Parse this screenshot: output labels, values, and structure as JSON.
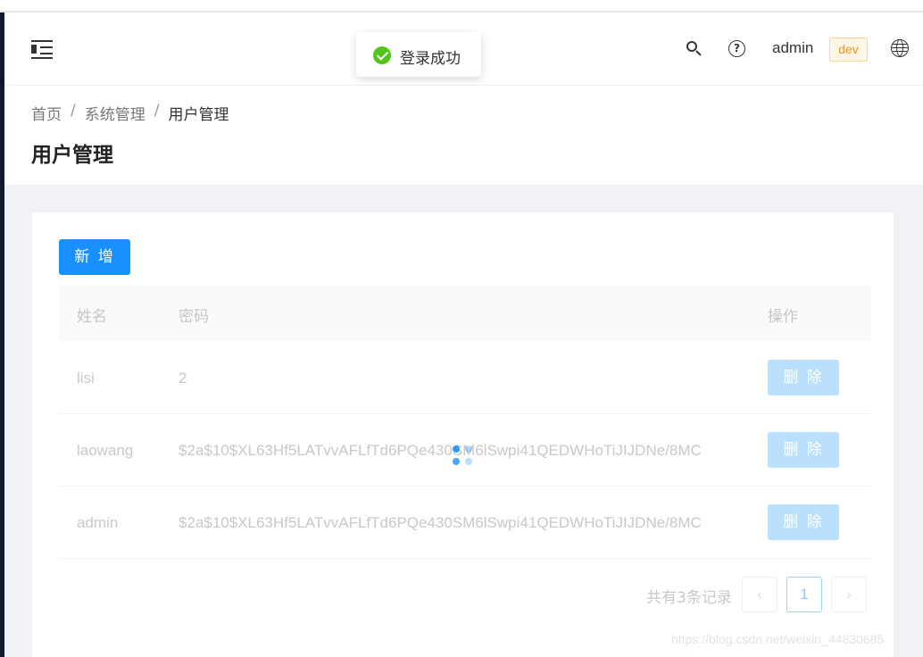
{
  "header": {
    "user_name": "admin",
    "env_badge": "dev",
    "colors": {
      "accent": "#1890ff",
      "badge_text": "#fa8c16",
      "success": "#52c41a"
    }
  },
  "toast": {
    "message": "登录成功",
    "icon": "check-circle-icon"
  },
  "breadcrumb": {
    "items": [
      "首页",
      "系统管理",
      "用户管理"
    ],
    "separator": "/"
  },
  "page": {
    "title": "用户管理"
  },
  "toolbar": {
    "add_label": "新 增"
  },
  "table": {
    "columns": [
      "姓名",
      "密码",
      "操作"
    ],
    "rows": [
      {
        "name": "lisi",
        "password": "2",
        "action": "删 除"
      },
      {
        "name": "laowang",
        "password": "$2a$10$XL63Hf5LATvvAFLfTd6PQe430SM6lSwpi41QEDWHoTiJIJDNe/8MC",
        "action": "删 除"
      },
      {
        "name": "admin",
        "password": "$2a$10$XL63Hf5LATvvAFLfTd6PQe430SM6lSwpi41QEDWHoTiJIJDNe/8MC",
        "action": "删 除"
      }
    ]
  },
  "pagination": {
    "total_text": "共有3条记录",
    "current_page": "1",
    "prev": "‹",
    "next": "›"
  },
  "watermark": "https://blog.csdn.net/weixin_44830685"
}
